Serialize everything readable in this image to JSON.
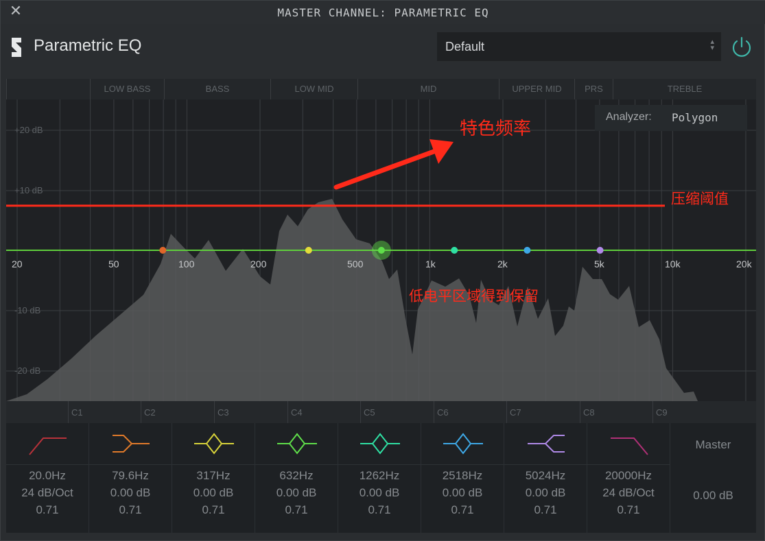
{
  "window": {
    "title": "MASTER CHANNEL: PARAMETRIC EQ",
    "close_icon": "close-icon"
  },
  "header": {
    "app_name": "Parametric EQ",
    "logo_icon": "s-logo-icon",
    "preset": "Default",
    "power_icon": "power-icon",
    "accent": "#3fb6a8"
  },
  "band_regions": [
    "LOW BASS",
    "BASS",
    "LOW MID",
    "MID",
    "UPPER MID",
    "PRS",
    "TREBLE"
  ],
  "db_labels": [
    "+20 dB",
    "+10 dB",
    "-10 dB",
    "-20 dB"
  ],
  "freq_labels": [
    "20",
    "50",
    "100",
    "200",
    "500",
    "1k",
    "2k",
    "5k",
    "10k",
    "20k"
  ],
  "analyzer": {
    "label": "Analyzer:",
    "value": "Polygon"
  },
  "annotations": {
    "arrow_text": "特色频率",
    "threshold_text": "压缩阈值",
    "low_level_text": "低电平区域得到保留",
    "color": "#ff2a1a"
  },
  "octaves": [
    "C1",
    "C2",
    "C3",
    "C4",
    "C5",
    "C6",
    "C7",
    "C8",
    "C9"
  ],
  "eq_curve_color": "#5fce3c",
  "nodes": [
    {
      "freq": 79.6,
      "color": "#e0662a"
    },
    {
      "freq": 317,
      "color": "#e3dc3a"
    },
    {
      "freq": 632,
      "color": "#5fde4a"
    },
    {
      "freq": 1262,
      "color": "#2fe0a3"
    },
    {
      "freq": 2518,
      "color": "#3ea8e6"
    },
    {
      "freq": 5024,
      "color": "#b08ae8"
    }
  ],
  "bands": [
    {
      "id": "low-cut",
      "icon": "low-cut-icon",
      "color": "#b8323a",
      "freq": "20.0Hz",
      "gain": "24 dB/Oct",
      "q": "0.71"
    },
    {
      "id": "low-shelf",
      "icon": "low-shelf-icon",
      "color": "#e07a2a",
      "freq": "79.6Hz",
      "gain": "0.00 dB",
      "q": "0.71"
    },
    {
      "id": "bell-1",
      "icon": "bell-icon",
      "color": "#d7d23a",
      "freq": "317Hz",
      "gain": "0.00 dB",
      "q": "0.71"
    },
    {
      "id": "bell-2",
      "icon": "bell-icon",
      "color": "#5fde4a",
      "freq": "632Hz",
      "gain": "0.00 dB",
      "q": "0.71"
    },
    {
      "id": "bell-3",
      "icon": "bell-icon",
      "color": "#2fe0a3",
      "freq": "1262Hz",
      "gain": "0.00 dB",
      "q": "0.71"
    },
    {
      "id": "bell-4",
      "icon": "bell-icon",
      "color": "#3ea8e6",
      "freq": "2518Hz",
      "gain": "0.00 dB",
      "q": "0.71"
    },
    {
      "id": "high-shelf",
      "icon": "high-shelf-icon",
      "color": "#b08ae8",
      "freq": "5024Hz",
      "gain": "0.00 dB",
      "q": "0.71"
    },
    {
      "id": "high-cut",
      "icon": "high-cut-icon",
      "color": "#b03076",
      "freq": "20000Hz",
      "gain": "24 dB/Oct",
      "q": "0.71"
    }
  ],
  "master": {
    "label": "Master",
    "value": "0.00 dB"
  }
}
